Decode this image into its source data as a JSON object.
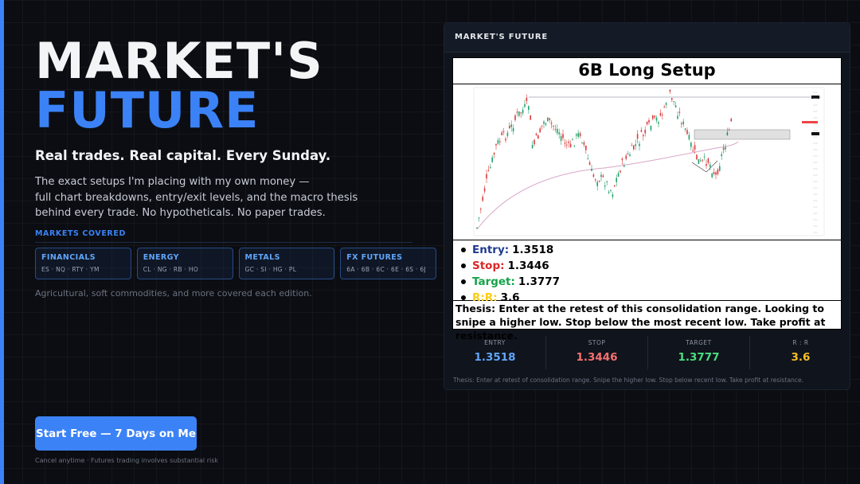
{
  "hero": {
    "title_line1": "MARKET'S",
    "title_line2": "FUTURE",
    "tagline": "Real trades. Real capital. Every Sunday.",
    "description_lines": [
      "The exact setups I'm placing with my own money —",
      "full chart breakdowns, entry/exit levels, and the macro thesis",
      "behind every trade. No hypotheticals. No paper trades."
    ]
  },
  "markets": {
    "label": "MARKETS COVERED",
    "cards": [
      {
        "title": "FINANCIALS",
        "items": "ES · NQ · RTY · YM"
      },
      {
        "title": "ENERGY",
        "items": "CL · NG · RB · HO"
      },
      {
        "title": "METALS",
        "items": "GC · SI · HG · PL"
      },
      {
        "title": "FX FUTURES",
        "items": "6A · 6B · 6C · 6E · 6S · 6J"
      }
    ],
    "more_note": "Agricultural, soft commodities, and more covered each edition."
  },
  "cta": {
    "label": "Start Free — 7 Days on Me",
    "fine_print": "Cancel anytime  ·  Futures trading involves substantial risk"
  },
  "panel": {
    "header": "MARKET'S FUTURE",
    "setup_title": "6B Long Setup",
    "levels": [
      {
        "key": "Entry:",
        "value": "1.3518",
        "color": "#1f3b8f"
      },
      {
        "key": "Stop:",
        "value": "1.3446",
        "color": "#dc2626"
      },
      {
        "key": "Target:",
        "value": "1.3777",
        "color": "#16a34a"
      },
      {
        "key": "R:R:",
        "value": "3.6",
        "color": "#facc15"
      }
    ],
    "thesis": "Thesis: Enter at the retest of this consolidation range. Looking to snipe a higher low. Stop below the most recent low. Take profit at resistance.",
    "stats": [
      {
        "label": "ENTRY",
        "value": "1.3518",
        "color": "#60a5fa"
      },
      {
        "label": "STOP",
        "value": "1.3446",
        "color": "#f87171"
      },
      {
        "label": "TARGET",
        "value": "1.3777",
        "color": "#4ade80"
      },
      {
        "label": "R : R",
        "value": "3.6",
        "color": "#fbbf24"
      }
    ],
    "note": "Thesis: Enter at retest of consolidation range. Snipe the higher low. Stop below recent low. Take profit at resistance."
  },
  "colors": {
    "accent": "#3b82f6",
    "background": "#0b0d12"
  }
}
